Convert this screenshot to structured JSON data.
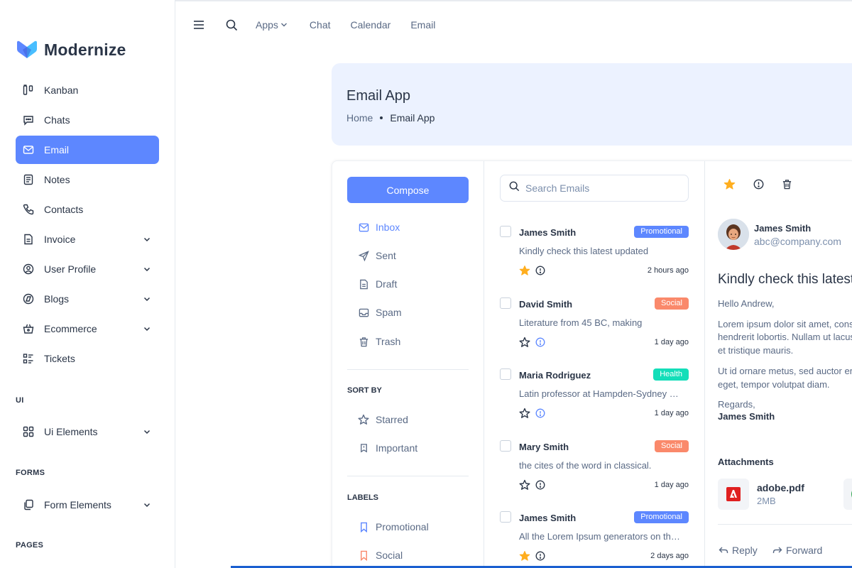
{
  "brand": {
    "name": "Modernize"
  },
  "sidebar": {
    "items": [
      {
        "label": "Kanban",
        "icon": "kanban-icon",
        "chevron": false,
        "active": false
      },
      {
        "label": "Chats",
        "icon": "chat-icon",
        "chevron": false,
        "active": false
      },
      {
        "label": "Email",
        "icon": "mail-icon",
        "chevron": false,
        "active": true
      },
      {
        "label": "Notes",
        "icon": "notes-icon",
        "chevron": false,
        "active": false
      },
      {
        "label": "Contacts",
        "icon": "phone-icon",
        "chevron": false,
        "active": false
      },
      {
        "label": "Invoice",
        "icon": "invoice-icon",
        "chevron": true,
        "active": false
      },
      {
        "label": "User Profile",
        "icon": "user-circle-icon",
        "chevron": true,
        "active": false
      },
      {
        "label": "Blogs",
        "icon": "blog-icon",
        "chevron": true,
        "active": false
      },
      {
        "label": "Ecommerce",
        "icon": "basket-icon",
        "chevron": true,
        "active": false
      },
      {
        "label": "Tickets",
        "icon": "ticket-icon",
        "chevron": false,
        "active": false
      }
    ],
    "section_ui": "UI",
    "ui_item": "Ui Elements",
    "section_forms": "FORMS",
    "forms_item": "Form Elements",
    "section_pages": "PAGES"
  },
  "topbar": {
    "apps": "Apps",
    "chat": "Chat",
    "calendar": "Calendar",
    "email": "Email"
  },
  "banner": {
    "title": "Email App",
    "crumb_home": "Home",
    "crumb_current": "Email App"
  },
  "folders": {
    "compose": "Compose",
    "inbox": "Inbox",
    "sent": "Sent",
    "draft": "Draft",
    "spam": "Spam",
    "trash": "Trash",
    "sort_by": "SORT BY",
    "starred": "Starred",
    "important": "Important",
    "labels": "LABELS",
    "promotional": "Promotional",
    "social": "Social"
  },
  "search": {
    "placeholder": "Search Emails"
  },
  "emails": [
    {
      "from": "James Smith",
      "label": "Promotional",
      "subject": "Kindly check this latest updated",
      "time": "2 hours ago",
      "starred": true
    },
    {
      "from": "David Smith",
      "label": "Social",
      "subject": "Literature from 45 BC, making",
      "time": "1 day ago",
      "starred": false
    },
    {
      "from": "Maria Rodriguez",
      "label": "Health",
      "subject": "Latin professor at Hampden-Sydney College",
      "time": "1 day ago",
      "starred": false
    },
    {
      "from": "Mary Smith",
      "label": "Social",
      "subject": "the cites of the word in classical.",
      "time": "1 day ago",
      "starred": false
    },
    {
      "from": "James Smith",
      "label": "Promotional",
      "subject": "All the Lorem Ipsum generators on the Internet",
      "time": "2 days ago",
      "starred": true
    }
  ],
  "colors": {
    "primary": "#5d87ff",
    "promotional": "#5d87ff",
    "social": "#fa896b",
    "health": "#13deb9",
    "star": "#ffae1f"
  },
  "message": {
    "sender_name": "James Smith",
    "sender_email": "abc@company.com",
    "subject": "Kindly check this latest updated",
    "greeting": "Hello Andrew,",
    "para1_line1": "Lorem ipsum dolor sit amet, consectetur",
    "para1_line2": "hendrerit lobortis. Nullam ut lacus",
    "para1_line3": "et tristique mauris.",
    "para2_line1": "Ut id ornare metus, sed auctor enim.",
    "para2_line2": "eget, tempor volutpat diam.",
    "regards": "Regards,",
    "regards_name": "James Smith",
    "attachments_title": "Attachments",
    "attachment_name": "adobe.pdf",
    "attachment_size": "2MB",
    "reply": "Reply",
    "forward": "Forward"
  }
}
